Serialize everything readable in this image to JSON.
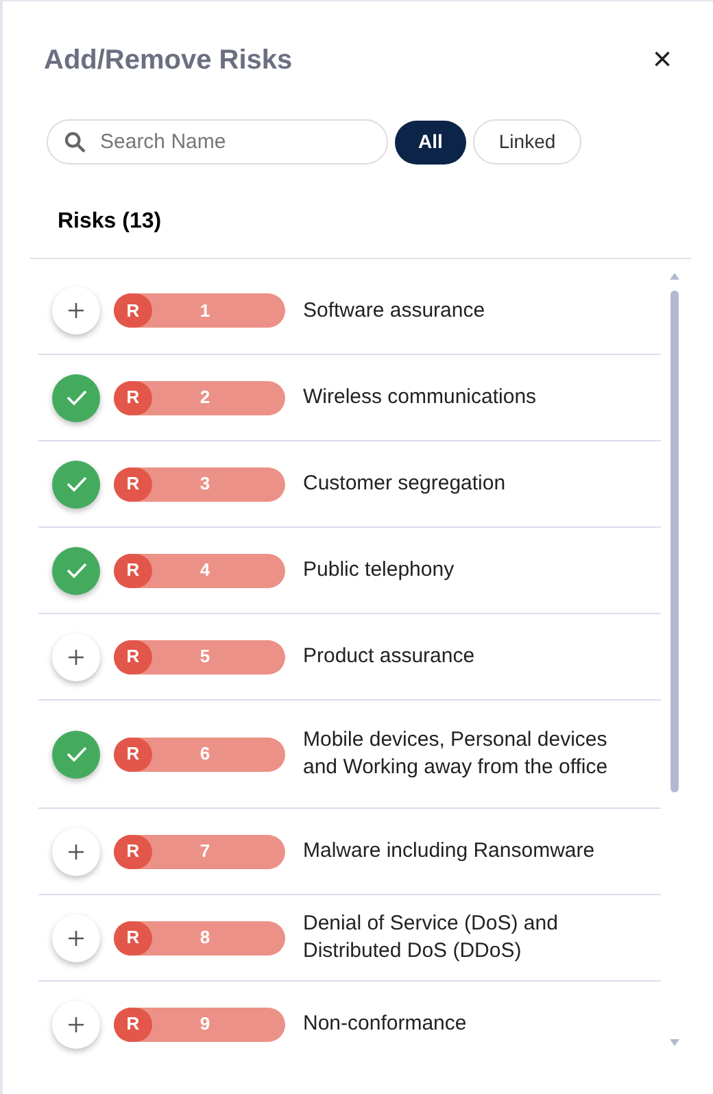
{
  "panel": {
    "title": "Add/Remove Risks",
    "close": "×"
  },
  "search": {
    "placeholder": "Search Name"
  },
  "filters": [
    {
      "label": "All",
      "selected": true
    },
    {
      "label": "Linked",
      "selected": false
    }
  ],
  "list_heading": "Risks (13)",
  "risks": [
    {
      "tag": "R",
      "number": "1",
      "name": "Software assurance",
      "linked": false
    },
    {
      "tag": "R",
      "number": "2",
      "name": "Wireless communications",
      "linked": true
    },
    {
      "tag": "R",
      "number": "3",
      "name": "Customer segregation",
      "linked": true
    },
    {
      "tag": "R",
      "number": "4",
      "name": "Public telephony",
      "linked": true
    },
    {
      "tag": "R",
      "number": "5",
      "name": "Product assurance",
      "linked": false
    },
    {
      "tag": "R",
      "number": "6",
      "name": "Mobile devices, Personal devices and Working away from the office",
      "linked": true
    },
    {
      "tag": "R",
      "number": "7",
      "name": "Malware including Ransomware",
      "linked": false
    },
    {
      "tag": "R",
      "number": "8",
      "name": "Denial of Service (DoS) and Distributed DoS (DDoS)",
      "linked": false
    },
    {
      "tag": "R",
      "number": "9",
      "name": "Non-conformance",
      "linked": false
    }
  ]
}
